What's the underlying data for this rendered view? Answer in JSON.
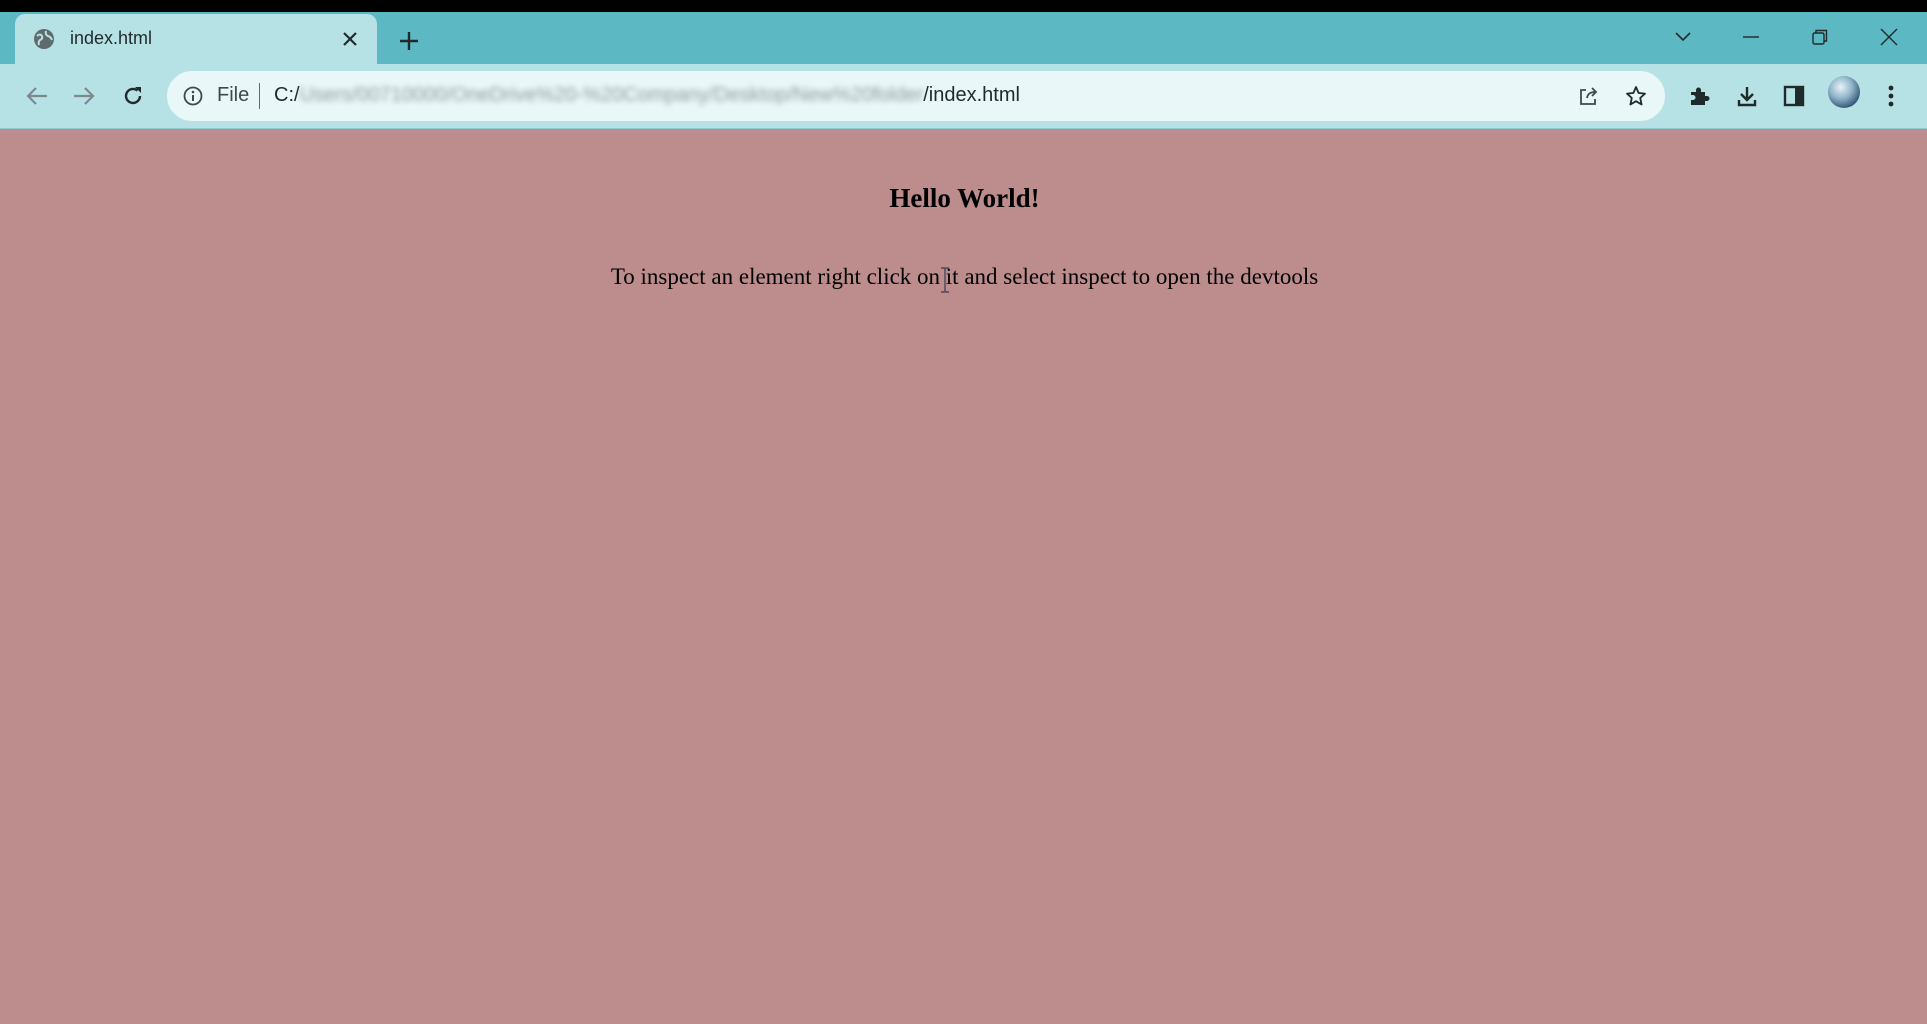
{
  "browser": {
    "tab": {
      "title": "index.html",
      "favicon": "globe-icon"
    },
    "new_tab_icon": "plus-icon",
    "window_controls": [
      "chevron-down-icon",
      "minimize-icon",
      "restore-icon",
      "close-icon"
    ],
    "nav": {
      "back_icon": "arrow-left-icon",
      "forward_icon": "arrow-right-icon",
      "reload_icon": "reload-icon"
    },
    "omnibox": {
      "info_icon": "info-icon",
      "scheme": "File",
      "url_prefix": "C:/",
      "url_blurred": "Users/00710000/OneDrive%20-%20Company/Desktop/New%20folder",
      "url_suffix": "/index.html",
      "share_icon": "share-icon",
      "bookmark_icon": "star-icon"
    },
    "toolbar_icons": [
      "puzzle-icon",
      "download-icon",
      "side-panel-icon",
      "avatar",
      "kebab-menu-icon"
    ]
  },
  "page": {
    "heading": "Hello World!",
    "text": "To inspect an element right click on it and select inspect to open the devtools",
    "background_color": "#bc8d8c"
  },
  "colors": {
    "tabstrip": "#5cb8c3",
    "toolbar": "#b6e2e6",
    "omnibox": "#eaf7f8"
  }
}
